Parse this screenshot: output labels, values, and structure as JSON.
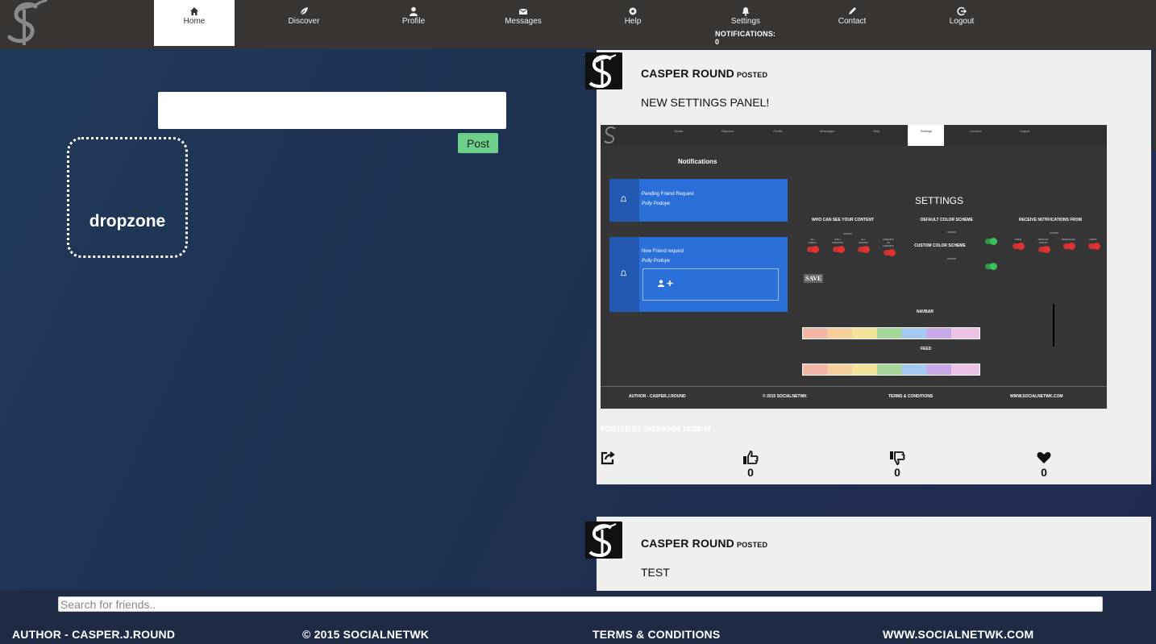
{
  "nav": {
    "items": [
      {
        "label": "Home",
        "icon": "home-icon",
        "active": true
      },
      {
        "label": "Discover",
        "icon": "leaf-icon",
        "active": false
      },
      {
        "label": "Profile",
        "icon": "user-icon",
        "active": false
      },
      {
        "label": "Messages",
        "icon": "envelope-icon",
        "active": false
      },
      {
        "label": "Help",
        "icon": "help-icon",
        "active": false
      },
      {
        "label": "Settings",
        "icon": "bell-icon",
        "active": false
      },
      {
        "label": "Contact",
        "icon": "pencil-icon",
        "active": false
      },
      {
        "label": "Logout",
        "icon": "logout-icon",
        "active": false
      }
    ],
    "notifications_label": "NOTIFICATIONS:",
    "notifications_count": "0",
    "logo_text": "SN"
  },
  "composer": {
    "input_value": "",
    "post_label": "Post",
    "dropzone_label": "dropzone"
  },
  "feed": [
    {
      "author": "CASPER ROUND",
      "posted_word": "POSTED",
      "text": "NEW SETTINGS PANEL!",
      "posted_at": "POSTED AT 2015-09-04 18:26:47",
      "likes": "0",
      "dislikes": "0",
      "hearts": "0"
    },
    {
      "author": "CASPER ROUND",
      "posted_word": "POSTED",
      "text": "TEST"
    }
  ],
  "screenshot": {
    "nav": [
      "Home",
      "Discover",
      "Profile",
      "Messages",
      "Help",
      "Settings",
      "Contact",
      "Logout"
    ],
    "notifications_title": "Notifications",
    "notif1_title": "Pending Friend Request",
    "notif1_name": "Polly Podoye",
    "notif2_title": "New Friend request",
    "notif2_name": "Polly Podoye",
    "settings_title": "SETTINGS",
    "who_can_see": "WHO CAN SEE YOUR CONTENT",
    "default_scheme": "DEFAULT COLOR SCHEME",
    "receive_from": "RECEIVE NOTIFICATIONS FROM",
    "custom_scheme": "CUSTOM COLOR SCHEME",
    "onoff": "ON/OFF",
    "visibility": [
      "ALL PUBLIC",
      "ONLY FRIENDS",
      "ALL HIDDEN",
      "FRIENDS OF FRIENDS"
    ],
    "receive": [
      "FEED",
      "PROFILE POSTS",
      "MESSAGES",
      "NEWS"
    ],
    "save": "SAVE",
    "navbar": "NAVBAR",
    "feed": "FEED",
    "footer": [
      "AUTHOR - CASPER.J.ROUND",
      "© 2015 SOCIALNETWK",
      "TERMS & CONDITIONS",
      "WWW.SOCIALNETWK.COM"
    ]
  },
  "footer": {
    "search_placeholder": "Search for friends..",
    "author": "AUTHOR - CASPER.J.ROUND",
    "copyright": "© 2015 SOCIALNETWK",
    "terms": "TERMS & CONDITIONS",
    "website": "WWW.SOCIALNETWK.COM"
  },
  "colors": {
    "nav_bg": "#383532",
    "page_bg": "#1e3350",
    "card_bg": "#efefef",
    "post_button": "#6cd08a",
    "footer_bg": "#1f2a45"
  }
}
